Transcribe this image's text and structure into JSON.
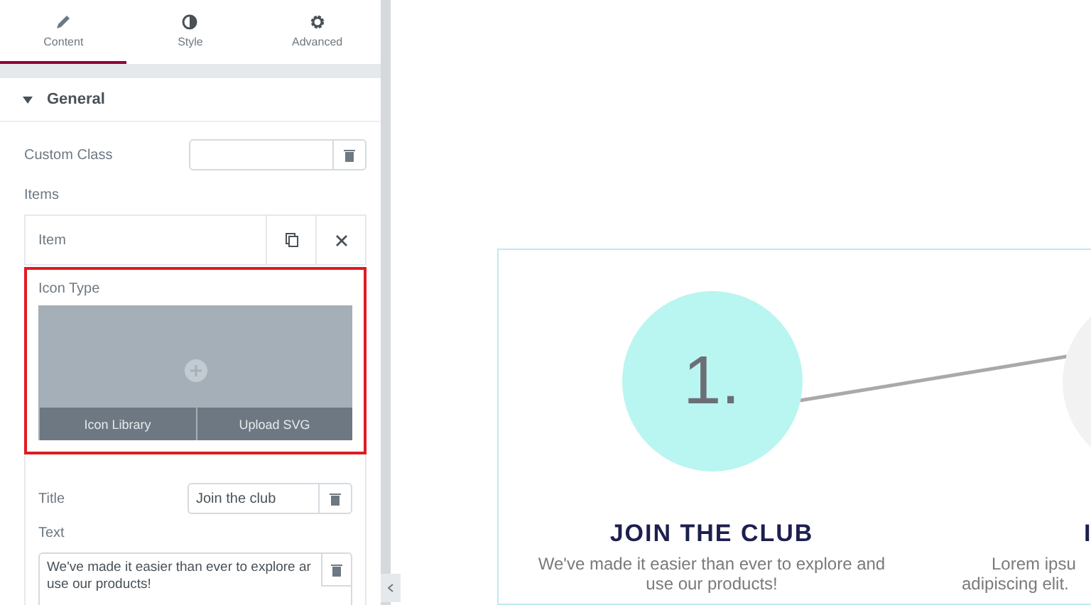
{
  "tabs": [
    {
      "label": "Content",
      "selected": true
    },
    {
      "label": "Style",
      "selected": false
    },
    {
      "label": "Advanced",
      "selected": false
    }
  ],
  "section": {
    "title": "General",
    "expanded": true
  },
  "custom_class": {
    "label": "Custom Class"
  },
  "items_label": "Items",
  "item": {
    "title": "Item"
  },
  "icon_type": {
    "label": "Icon Type",
    "buttons": [
      "Icon Library",
      "Upload SVG"
    ]
  },
  "title_field": {
    "label": "Title",
    "value": "Join the club"
  },
  "text_field": {
    "label": "Text",
    "value": "We've made it easier than ever to explore ar\nuse our products!"
  },
  "steps": [
    {
      "number": "1.",
      "heading": "JOIN THE CLUB",
      "lines": [
        "We've made it easier than ever to explore and",
        "use our products!"
      ]
    },
    {
      "heading": "I",
      "lines": [
        "Lorem ipsu",
        "adipiscing elit."
      ]
    }
  ]
}
